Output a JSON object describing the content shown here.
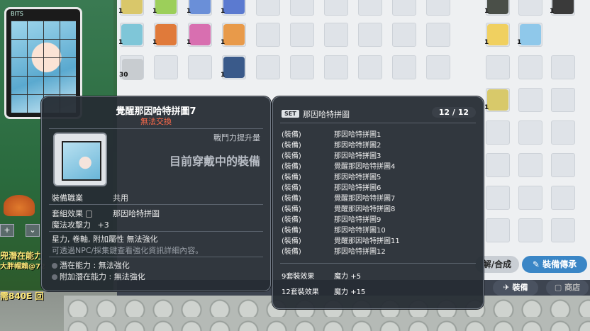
{
  "left_panel": {
    "frame_label": "BITS",
    "status_line1": "兜潛在能力",
    "status_line2": "大胖帽賴@72",
    "status_line3": "需840E 回"
  },
  "inventory": {
    "quantities": [
      "1",
      "1",
      "1",
      "1",
      "1",
      "1",
      "1",
      "1",
      "1",
      "1",
      "1",
      "1",
      "30",
      "1",
      "1",
      "1",
      "1",
      "1"
    ],
    "buttons": {
      "disassemble": "解/合成",
      "equip_transfer": "裝備傳承",
      "equip": "裝備",
      "shop": "商店"
    }
  },
  "tooltip_left": {
    "title": "覺醒那因哈特拼圖7",
    "tradeable": "無法交換",
    "power_label": "戰鬥力提升量",
    "equipped_label": "目前穿戴中的裝備",
    "job_label": "裝備職業",
    "job_value": "共用",
    "set_label": "套組效果",
    "set_value": "那因哈特拼圖",
    "stat_label": "魔法攻擊力",
    "stat_value": "+3",
    "notes": "星力, 卷軸, 附加屬性 無法強化",
    "hint": "可透過NPC/採集鍵查看強化資訊詳細內容。",
    "potential_label": "潛在能力",
    "potential_value": "無法強化",
    "add_potential_label": "附加潛在能力",
    "add_potential_value": "無法強化"
  },
  "tooltip_right": {
    "badge": "SET",
    "set_name": "那因哈特拼圖",
    "count": "12 / 12",
    "items": [
      {
        "k": "(裝備)",
        "v": "那因哈特拼圖1"
      },
      {
        "k": "(裝備)",
        "v": "那因哈特拼圖2"
      },
      {
        "k": "(裝備)",
        "v": "那因哈特拼圖3"
      },
      {
        "k": "(裝備)",
        "v": "覺醒那因哈特拼圖4"
      },
      {
        "k": "(裝備)",
        "v": "那因哈特拼圖5"
      },
      {
        "k": "(裝備)",
        "v": "那因哈特拼圖6"
      },
      {
        "k": "(裝備)",
        "v": "覺醒那因哈特拼圖7"
      },
      {
        "k": "(裝備)",
        "v": "覺醒那因哈特拼圖8"
      },
      {
        "k": "(裝備)",
        "v": "那因哈特拼圖9"
      },
      {
        "k": "(裝備)",
        "v": "那因哈特拼圖10"
      },
      {
        "k": "(裝備)",
        "v": "覺醒那因哈特拼圖11"
      },
      {
        "k": "(裝備)",
        "v": "那因哈特拼圖12"
      }
    ],
    "effect9_label": "9套裝效果",
    "effect9_stat": "魔力",
    "effect9_value": "+5",
    "effect12_label": "12套裝效果",
    "effect12_stat": "魔力",
    "effect12_value": "+15"
  },
  "colors": {
    "tooltip_bg": "#262c34",
    "untradeable": "#ff6a4a",
    "accent_blue": "#3a86c6"
  }
}
